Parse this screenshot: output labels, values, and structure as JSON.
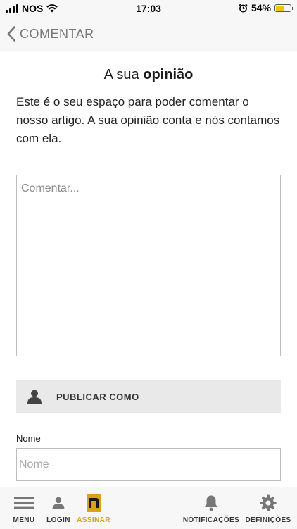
{
  "status_bar": {
    "carrier": "NOS",
    "time": "17:03",
    "battery": "54%",
    "battery_level": 0.54
  },
  "header": {
    "title": "COMENTAR"
  },
  "main": {
    "title_prefix": "A sua",
    "title_bold": "opinião",
    "intro": "Este é o seu espaço para poder comentar o nosso artigo. A sua opinião conta e nós contamos com ela.",
    "comment_placeholder": "Comentar...",
    "publish_label": "PUBLICAR COMO",
    "name_label": "Nome",
    "name_placeholder": "Nome"
  },
  "tabbar": {
    "items": [
      {
        "label": "MENU",
        "icon": "menu-icon"
      },
      {
        "label": "LOGIN",
        "icon": "user-icon"
      },
      {
        "label": "ASSINAR",
        "icon": "brand-n-icon",
        "active": true
      },
      {
        "label": "NOTIFICAÇÕES",
        "icon": "bell-icon"
      },
      {
        "label": "DEFINIÇÕES",
        "icon": "gear-icon"
      }
    ]
  },
  "colors": {
    "accent": "#d9a21a",
    "battery": "#f4c20d"
  }
}
